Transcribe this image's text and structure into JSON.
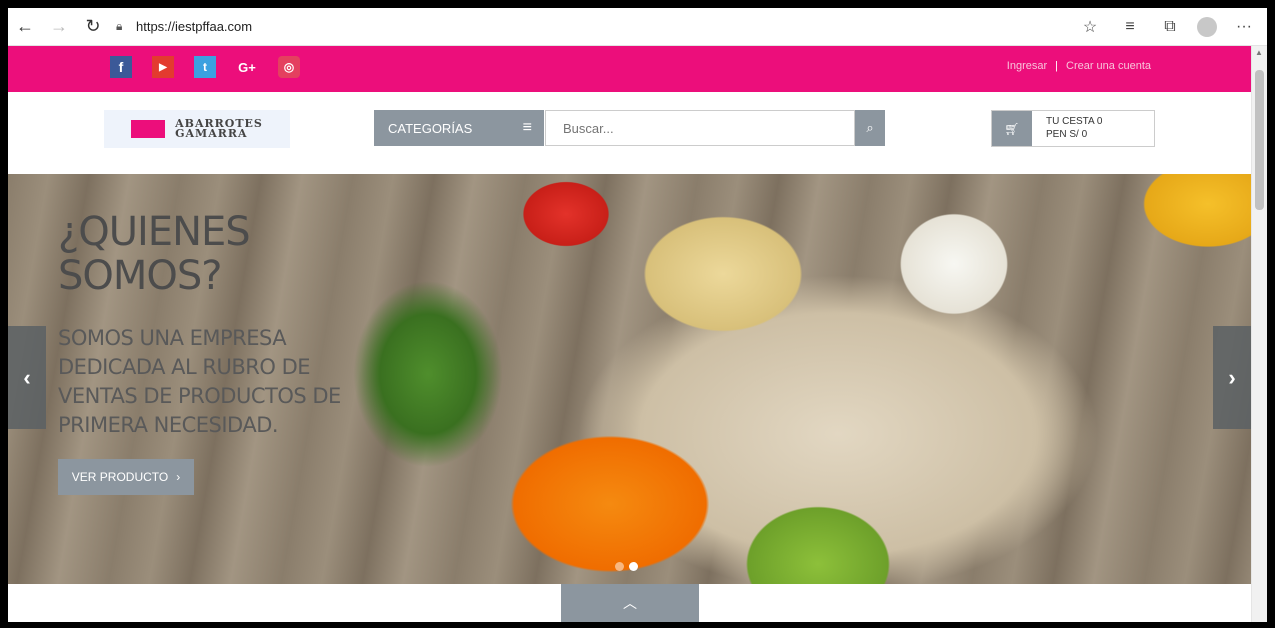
{
  "browser": {
    "url": "https://iestpffaa.com",
    "icons": [
      "back-arrow-icon",
      "forward-arrow-icon",
      "refresh-icon",
      "lock-icon",
      "favorite-add-icon",
      "favorites-icon",
      "collections-icon",
      "profile-icon",
      "more-icon"
    ]
  },
  "topbar": {
    "social": [
      {
        "name": "facebook-icon",
        "glyph": "f"
      },
      {
        "name": "youtube-icon",
        "glyph": "▶"
      },
      {
        "name": "twitter-icon",
        "glyph": "t"
      },
      {
        "name": "google-plus-icon",
        "glyph": "G+"
      },
      {
        "name": "instagram-icon",
        "glyph": "◎"
      }
    ],
    "login_label": "Ingresar",
    "separator": "|",
    "register_label": "Crear una cuenta",
    "background_color": "#ec0e7b"
  },
  "header": {
    "logo_text_line1": "ABARROTES",
    "logo_text_line2": "GAMARRA",
    "categories_label": "CATEGORÍAS",
    "search_placeholder": "Buscar...",
    "cart_label": "TU CESTA 0",
    "cart_total": "PEN S/ 0"
  },
  "hero": {
    "title": "¿QUIENES SOMOS?",
    "text": "SOMOS UNA EMPRESA DEDICADA AL RUBRO DE VENTAS DE PRODUCTOS DE PRIMERA NECESIDAD.",
    "button_label": "VER PRODUCTO",
    "slides_total": 2,
    "active_slide": 2
  }
}
